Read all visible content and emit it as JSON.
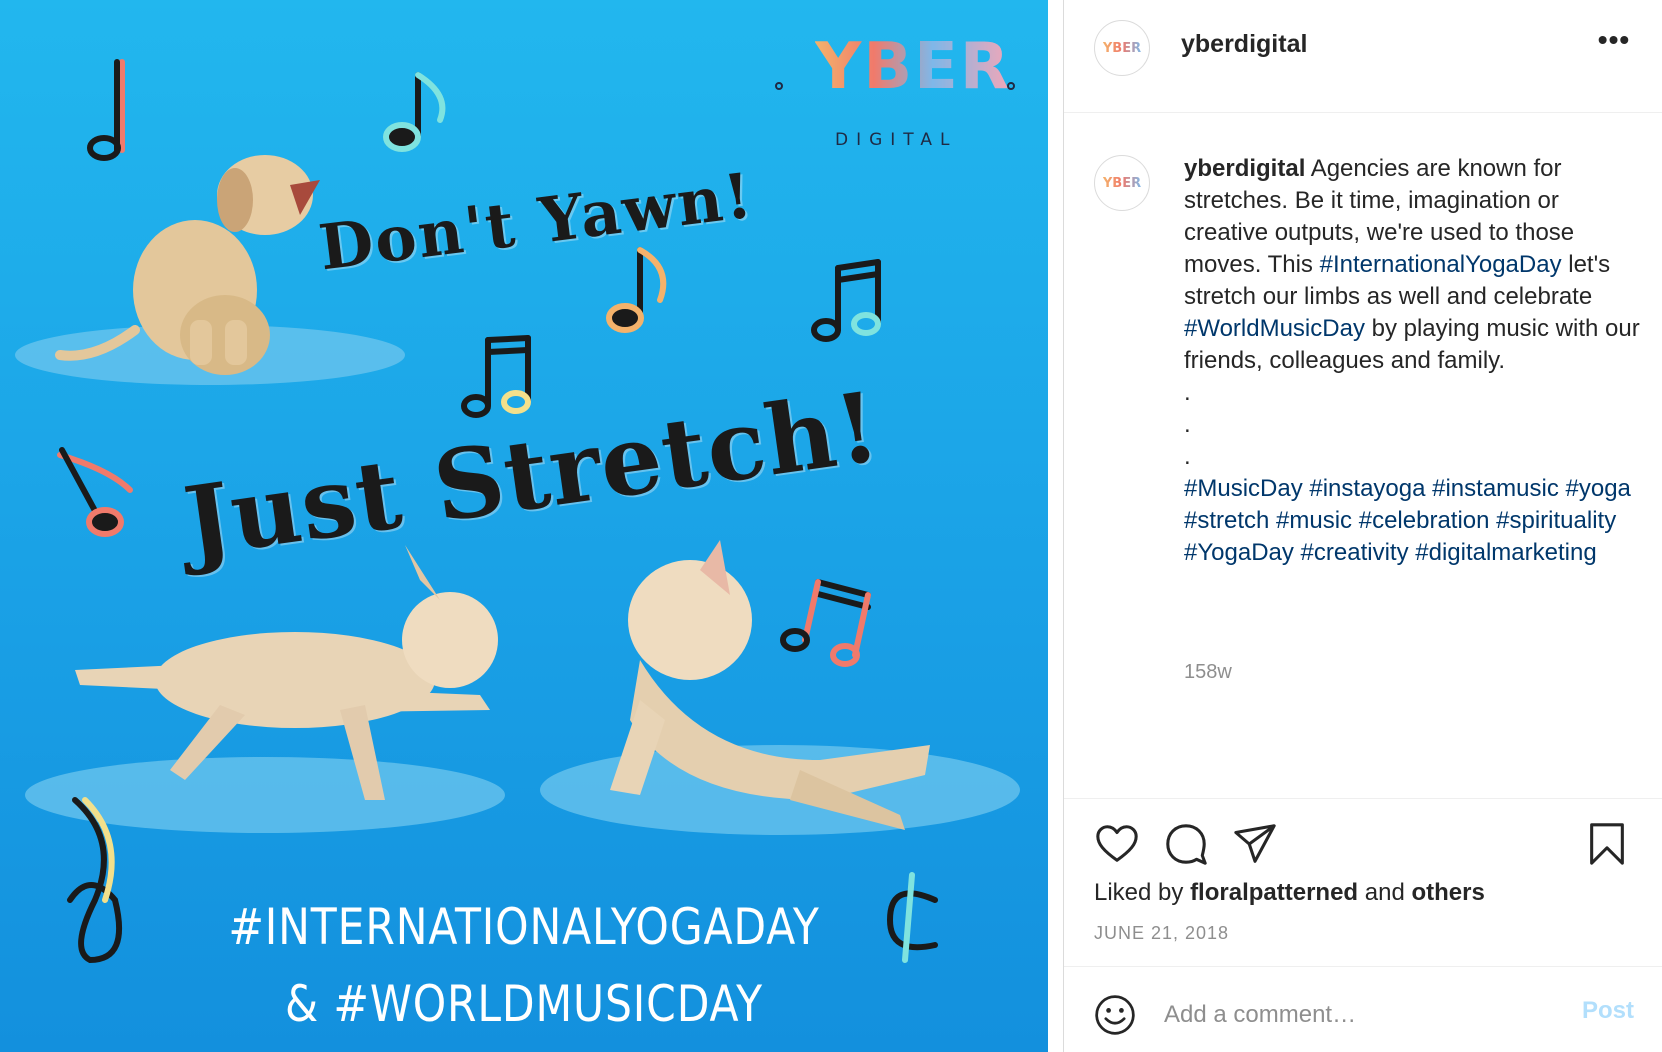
{
  "image": {
    "headline_top": "Don't Yawn!",
    "headline_main": "Just Stretch!",
    "bottom_line_1": "#INTERNATIONALYOGADAY",
    "bottom_line_2": "& #WORLDMUSICDAY",
    "logo_word": "YBER",
    "logo_sub": "DIGITAL",
    "background_color": "#1aa1e6",
    "note_colors": [
      "#f07a6b",
      "#7fe3df",
      "#f4b26b",
      "#f3e08b"
    ]
  },
  "header": {
    "username": "yberdigital",
    "more_icon": "•••"
  },
  "caption": {
    "username": "yberdigital",
    "text_1": " Agencies are known for stretches. Be it time, imagination or creative outputs, we're used to those moves. This ",
    "tag_1": "#InternationalYogaDay",
    "text_2": " let's stretch our limbs as well and celebrate ",
    "tag_2": "#WorldMusicDay",
    "text_3": " by playing music with our friends, colleagues and family.",
    "dots": [
      ".",
      ".",
      "."
    ],
    "hashtags": "#MusicDay #instayoga #instamusic #yoga #stretch #music #celebration #spirituality #YogaDay #creativity #digitalmarketing",
    "age": "158w"
  },
  "actions": {
    "liked_prefix": "Liked by ",
    "liked_user": "floralpatterned",
    "liked_middle": " and ",
    "liked_suffix": "others",
    "date": "JUNE 21, 2018"
  },
  "comment": {
    "placeholder": "Add a comment…",
    "post_label": "Post"
  },
  "colors": {
    "link": "#00376b",
    "muted": "#8e8e8e",
    "post_disabled": "#b2dffc"
  }
}
